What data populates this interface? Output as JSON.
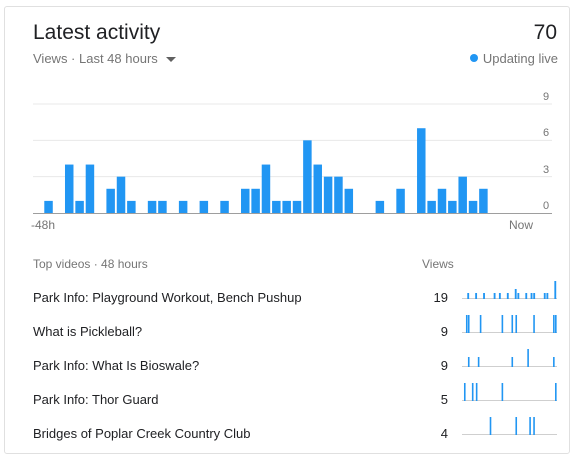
{
  "header": {
    "title": "Latest activity",
    "total_views": "70",
    "subtitle": "Views · Last 48 hours",
    "live_label": "Updating live"
  },
  "colors": {
    "accent": "#2196f3",
    "baseline": "#9e9e9e",
    "grid": "#e8e8e8"
  },
  "chart_data": {
    "type": "bar",
    "title": "",
    "xlabel": "",
    "ylabel": "",
    "x_start_label": "-48h",
    "x_end_label": "Now",
    "yticks": [
      "9",
      "6",
      "3",
      "0"
    ],
    "ylim": [
      0,
      9
    ],
    "grid": true,
    "categories_count": 48,
    "values": [
      0,
      1,
      0,
      4,
      1,
      4,
      0,
      2,
      3,
      1,
      0,
      1,
      1,
      0,
      1,
      0,
      1,
      0,
      1,
      0,
      2,
      2,
      4,
      1,
      1,
      1,
      6,
      4,
      3,
      3,
      2,
      0,
      0,
      1,
      0,
      2,
      0,
      7,
      1,
      2,
      1,
      3,
      1,
      2,
      0,
      0,
      0,
      0
    ]
  },
  "table": {
    "header_left": "Top videos · 48 hours",
    "header_right": "Views",
    "rows": [
      {
        "title": "Park Info: Playground Workout, Bench Pushup",
        "views": "19",
        "spark": [
          0,
          0,
          1,
          0,
          0,
          1,
          0,
          0,
          1,
          0,
          0,
          0,
          1,
          0,
          1,
          0,
          0,
          1,
          0,
          0,
          2,
          1,
          0,
          0,
          1,
          0,
          1,
          1,
          0,
          0,
          0,
          1,
          1,
          0,
          0,
          4
        ]
      },
      {
        "title": "What is Pickleball?",
        "views": "9",
        "spark": [
          0,
          0,
          1,
          1,
          0,
          0,
          0,
          0,
          0,
          1,
          0,
          0,
          0,
          0,
          0,
          0,
          0,
          0,
          0,
          0,
          1,
          0,
          0,
          0,
          0,
          1,
          0,
          1,
          0,
          0,
          0,
          0,
          0,
          0,
          0,
          0,
          1,
          0,
          0,
          0,
          0,
          0,
          0,
          0,
          0,
          0,
          1,
          1
        ]
      },
      {
        "title": "Park Info: What Is Bioswale?",
        "views": "9",
        "spark": [
          0,
          0,
          0,
          1,
          0,
          0,
          0,
          0,
          1,
          0,
          0,
          0,
          0,
          0,
          0,
          0,
          0,
          0,
          0,
          0,
          0,
          0,
          0,
          0,
          0,
          1,
          0,
          0,
          0,
          0,
          0,
          0,
          0,
          2,
          0,
          0,
          0,
          0,
          0,
          0,
          0,
          0,
          0,
          0,
          0,
          0,
          1,
          0
        ]
      },
      {
        "title": "Park Info: Thor Guard",
        "views": "5",
        "spark": [
          0,
          1,
          0,
          0,
          0,
          1,
          0,
          1,
          0,
          0,
          0,
          0,
          0,
          0,
          0,
          0,
          0,
          0,
          0,
          0,
          1,
          0,
          0,
          0,
          0,
          0,
          0,
          0,
          0,
          0,
          0,
          0,
          0,
          0,
          0,
          0,
          0,
          0,
          0,
          0,
          0,
          0,
          0,
          0,
          0,
          0,
          0,
          1
        ]
      },
      {
        "title": "Bridges of Poplar Creek Country Club",
        "views": "4",
        "spark": [
          0,
          0,
          0,
          0,
          0,
          0,
          0,
          0,
          0,
          0,
          0,
          0,
          0,
          0,
          1,
          0,
          0,
          0,
          0,
          0,
          0,
          0,
          0,
          0,
          0,
          0,
          0,
          1,
          0,
          0,
          0,
          0,
          0,
          0,
          1,
          0,
          1,
          0,
          0,
          0,
          0,
          0,
          0,
          0,
          0,
          0,
          0,
          0
        ]
      }
    ]
  }
}
